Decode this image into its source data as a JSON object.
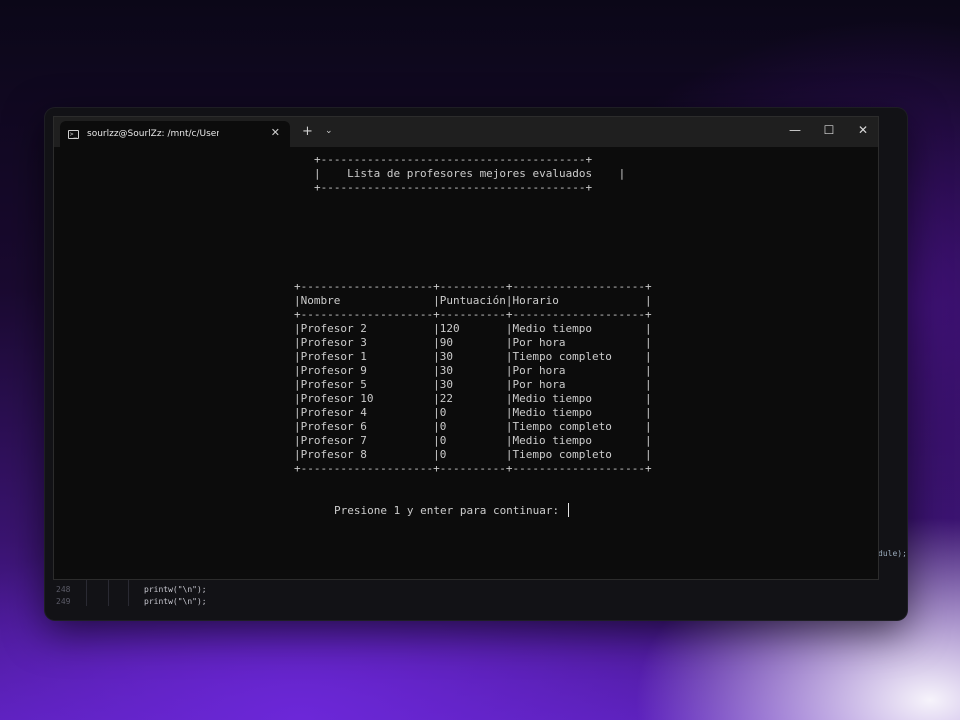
{
  "window": {
    "tab_title": "sourlzz@SourlZz: /mnt/c/Users",
    "tab_icon": ">_",
    "tab_close": "✕",
    "new_tab": "+",
    "dropdown": "⌄",
    "minimize": "—",
    "maximize": "☐",
    "close": "✕"
  },
  "console": {
    "title_border": "+----------------------------------------+",
    "title_line": "|    Lista de profesores mejores evaluados    |",
    "table_border": "+--------------------+----------+--------------------+",
    "header_line": "|Nombre              |Puntuación|Horario             |",
    "rows": [
      "|Profesor 2          |120       |Medio tiempo        |",
      "|Profesor 3          |90        |Por hora            |",
      "|Profesor 1          |30        |Tiempo completo     |",
      "|Profesor 9          |30        |Por hora            |",
      "|Profesor 5          |30        |Por hora            |",
      "|Profesor 10         |22        |Medio tiempo        |",
      "|Profesor 4          |0         |Medio tiempo        |",
      "|Profesor 6          |0         |Tiempo completo     |",
      "|Profesor 7          |0         |Medio tiempo        |",
      "|Profesor 8          |0         |Tiempo completo     |"
    ],
    "prompt": "Presione 1 y enter para continuar: "
  },
  "editor": {
    "line_numbers": [
      "248",
      "249"
    ],
    "code_lines": [
      "printw(\"\\n\");",
      "printw(\"\\n\");"
    ],
    "right_snippet": "dule);"
  }
}
